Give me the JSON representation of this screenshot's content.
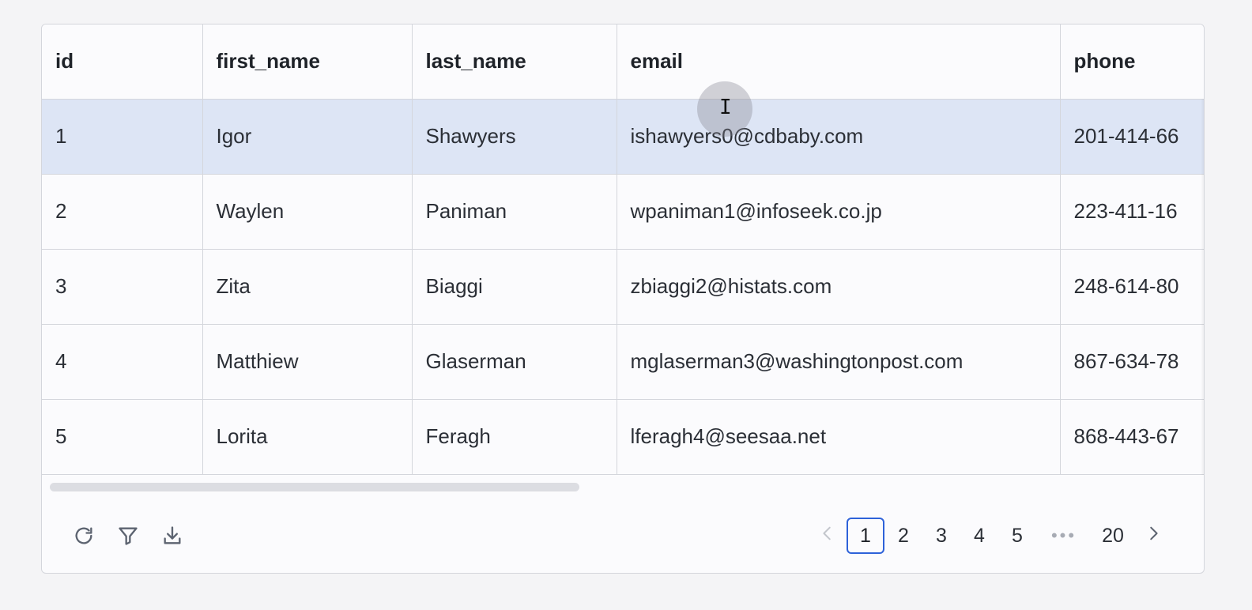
{
  "table": {
    "columns": [
      "id",
      "first_name",
      "last_name",
      "email",
      "phone"
    ],
    "rows": [
      [
        "1",
        "Igor",
        "Shawyers",
        "ishawyers0@cdbaby.com",
        "201-414-66"
      ],
      [
        "2",
        "Waylen",
        "Paniman",
        "wpaniman1@infoseek.co.jp",
        "223-411-16"
      ],
      [
        "3",
        "Zita",
        "Biaggi",
        "zbiaggi2@histats.com",
        "248-614-80"
      ],
      [
        "4",
        "Matthiew",
        "Glaserman",
        "mglaserman3@washingtonpost.com",
        "867-634-78"
      ],
      [
        "5",
        "Lorita",
        "Feragh",
        "lferagh4@seesaa.net",
        "868-443-67"
      ]
    ],
    "selected_row": 0
  },
  "toolbar": {
    "refresh_icon": "refresh-icon",
    "filter_icon": "filter-icon",
    "download_icon": "download-icon"
  },
  "pagination": {
    "prev_icon": "chevron-left-icon",
    "pages": [
      "1",
      "2",
      "3",
      "4",
      "5"
    ],
    "current": "1",
    "ellipsis": "•••",
    "last_page": "20",
    "next_icon": "chevron-right-icon"
  },
  "colors": {
    "selected_row": "#dde5f5",
    "active_page_border": "#2e62d9",
    "border": "#d4d6dc"
  }
}
